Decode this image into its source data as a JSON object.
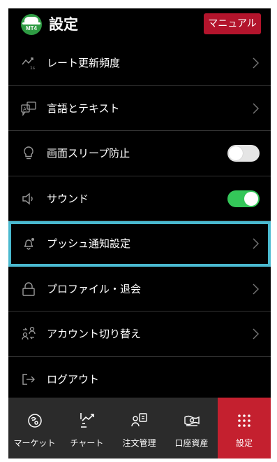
{
  "header": {
    "title": "設定",
    "logo_text": "MT4",
    "manual_label": "マニュアル"
  },
  "menu": [
    {
      "label": "レート更新頻度",
      "icon": "rate-update-icon",
      "type": "link"
    },
    {
      "label": "言語とテキスト",
      "icon": "language-icon",
      "type": "link"
    },
    {
      "label": "画面スリープ防止",
      "icon": "lightbulb-icon",
      "type": "toggle",
      "on": false
    },
    {
      "label": "サウンド",
      "icon": "speaker-icon",
      "type": "toggle",
      "on": true
    },
    {
      "label": "プッシュ通知設定",
      "icon": "bell-icon",
      "type": "link",
      "highlighted": true
    },
    {
      "label": "プロファイル・退会",
      "icon": "lock-icon",
      "type": "link"
    },
    {
      "label": "アカウント切り替え",
      "icon": "switch-account-icon",
      "type": "link"
    },
    {
      "label": "ログアウト",
      "icon": "logout-icon",
      "type": "action"
    }
  ],
  "tabs": [
    {
      "label": "マーケット",
      "icon": "market-icon"
    },
    {
      "label": "チャート",
      "icon": "chart-icon"
    },
    {
      "label": "注文管理",
      "icon": "order-icon"
    },
    {
      "label": "口座資産",
      "icon": "money-icon"
    },
    {
      "label": "設定",
      "icon": "grid-icon",
      "active": true
    }
  ],
  "colors": {
    "background": "#000000",
    "accent_red": "#c4202f",
    "toggle_on": "#34c759",
    "highlight": "#4ab9cf",
    "logo_green": "#2e9b43"
  }
}
